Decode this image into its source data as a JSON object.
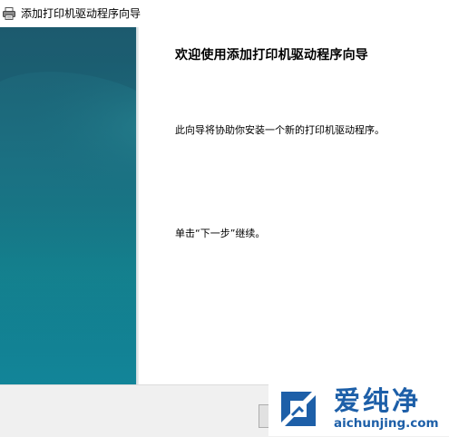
{
  "window": {
    "title": "添加打印机驱动程序向导",
    "icon": "printer-icon"
  },
  "wizard": {
    "heading": "欢迎使用添加打印机驱动程序向导",
    "description": "此向导将协助你安装一个新的打印机驱动程序。",
    "continue_hint": "单击“下一步”继续。"
  },
  "watermark": {
    "brand": "爱纯净",
    "url": "aichunjing.com",
    "color": "#1d5fa8"
  },
  "colors": {
    "side_panel_top": "#1e5f72",
    "side_panel_bottom": "#0f6f86",
    "footer": "#f0f0f0"
  }
}
